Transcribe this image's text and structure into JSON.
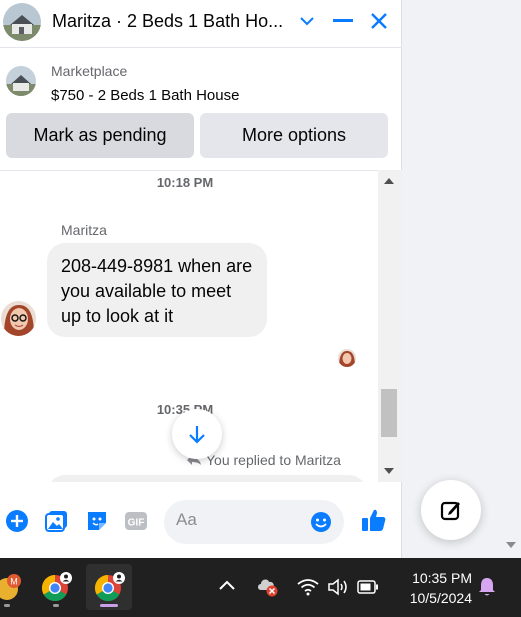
{
  "header": {
    "title": "Maritza · 2 Beds 1 Bath Ho...",
    "icons": [
      "house-avatar-icon",
      "chevron-down-icon",
      "minimize-icon",
      "close-icon"
    ]
  },
  "listing": {
    "source": "Marketplace",
    "title": "$750 - 2 Beds 1 Bath House"
  },
  "actions": {
    "pending_label": "Mark as pending",
    "more_label": "More options"
  },
  "conversation": {
    "time_first": "10:18 PM",
    "sender": "Maritza",
    "message": "208-449-8981  when are you available to meet up to look at it",
    "time_second": "10:35 PM",
    "replied_note": "You replied to Maritza"
  },
  "composer": {
    "placeholder": "Aa",
    "gif_label": "GIF",
    "icons": [
      "plus-icon",
      "photo-icon",
      "sticker-icon",
      "gif-icon",
      "emoji-icon",
      "like-icon"
    ]
  },
  "taskbar": {
    "apps": [
      "app-m-icon",
      "chrome-profile-icon",
      "chrome-profile-active-icon"
    ],
    "tray_icons": [
      "chevron-up-icon",
      "cloud-error-icon",
      "wifi-icon",
      "volume-icon",
      "battery-icon",
      "notification-bell-icon"
    ],
    "time": "10:35 PM",
    "date": "10/5/2024",
    "app_badge": "M"
  },
  "colors": {
    "accent": "#0084ff",
    "messenger_blue": "#0a7cff",
    "taskbar": "#202020",
    "bell": "#d7a6f0"
  }
}
